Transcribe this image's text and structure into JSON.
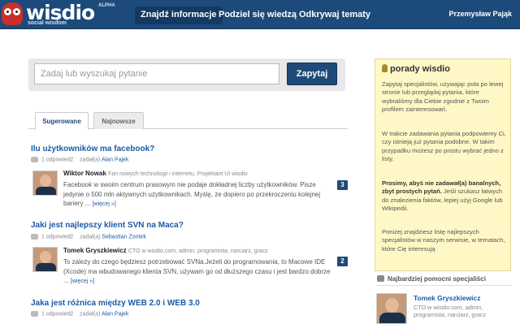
{
  "header": {
    "logo_text": "wisdio",
    "logo_sub": "social wisdom",
    "logo_badge": "ALPHA",
    "nav": [
      "Znajdź informacje",
      "Podziel się wiedzą",
      "Odkrywaj tematy"
    ],
    "user": "Przemysław Pająk"
  },
  "search": {
    "placeholder": "Zadaj lub wyszukaj pytanie",
    "button": "Zapytaj"
  },
  "tabs": [
    "Sugerowane",
    "Najnowsze"
  ],
  "questions": [
    {
      "title": "Ilu użytkowników ma facebook?",
      "answers_count": "1 odpowiedź",
      "asked_label": "zadał(a)",
      "author": "Alan Pajek",
      "answer": {
        "name": "Wiktor Nowak",
        "desc": "Fan nowych technologii i internetu, Projektant UI wisdio",
        "line1": "Facebook w swoim centrum prasowym nie podaje dokładnej liczby użytkowników. Pisze",
        "line2": "jedynie o 500 mln aktywnych użytkownikach. Myślę, że dopiero po przekroczeniu kolejnej",
        "line3": "bariery ...",
        "more": "[więcej »]",
        "votes": "3"
      }
    },
    {
      "title": "Jaki jest najlepszy klient SVN na Maca?",
      "answers_count": "1 odpowiedź",
      "asked_label": "zadał(a)",
      "author": "Sebastian Zontek",
      "answer": {
        "name": "Tomek Gryszkiewicz",
        "desc": "CTO w wisdio.com, admin, programista, narciarz, gracz",
        "line1": "To zależy do czego będziesz potrzebować SVNa.Jeżeli do programowania, to Macowe IDE",
        "line2": "(Xcode) ma wbudowanego klienta SVN, używam go od dłuższego czasu i jest bardzo dobrze",
        "line3": "...",
        "more": "[więcej »]",
        "votes": "2"
      }
    },
    {
      "title": "Jaka jest różnica między WEB 2.0 i WEB 3.0",
      "answers_count": "1 odpowiedź",
      "asked_label": "zadał(a)",
      "author": "Alan Pajek"
    }
  ],
  "tips": {
    "title": "porady wisdio",
    "p1": "Zapytaj specjalistów, używając pola po lewej stronie lub przeglądaj pytania, które wybraliśmy dla Ciebie zgodnie z Twoim profilem zainteresowań.",
    "p2": "W trakcie zadawania pytania podpowiemy Ci, czy istnieją już pytania podobne. W takim przypadku możesz po prostu wybrać jedno z listy.",
    "p3_bold": "Prosimy, abyś nie zadawał(a) banalnych, zbyt prostych pytań.",
    "p3_rest": " Jeśli szukasz łatwych do znalezienia faktów, lepiej użyj Google lub Wikipedii.",
    "p4": "Poniżej znajdziesz listę najlepszych specjalistów w naszym serwisie, w tematach, które Cię interesują"
  },
  "experts": {
    "heading": "Najbardziej pomocni specjaliści",
    "items": [
      {
        "name": "Tomek Gryszkiewicz",
        "desc": "CTO w wisdio.com, admin, programista, narciarz, gracz"
      }
    ]
  }
}
